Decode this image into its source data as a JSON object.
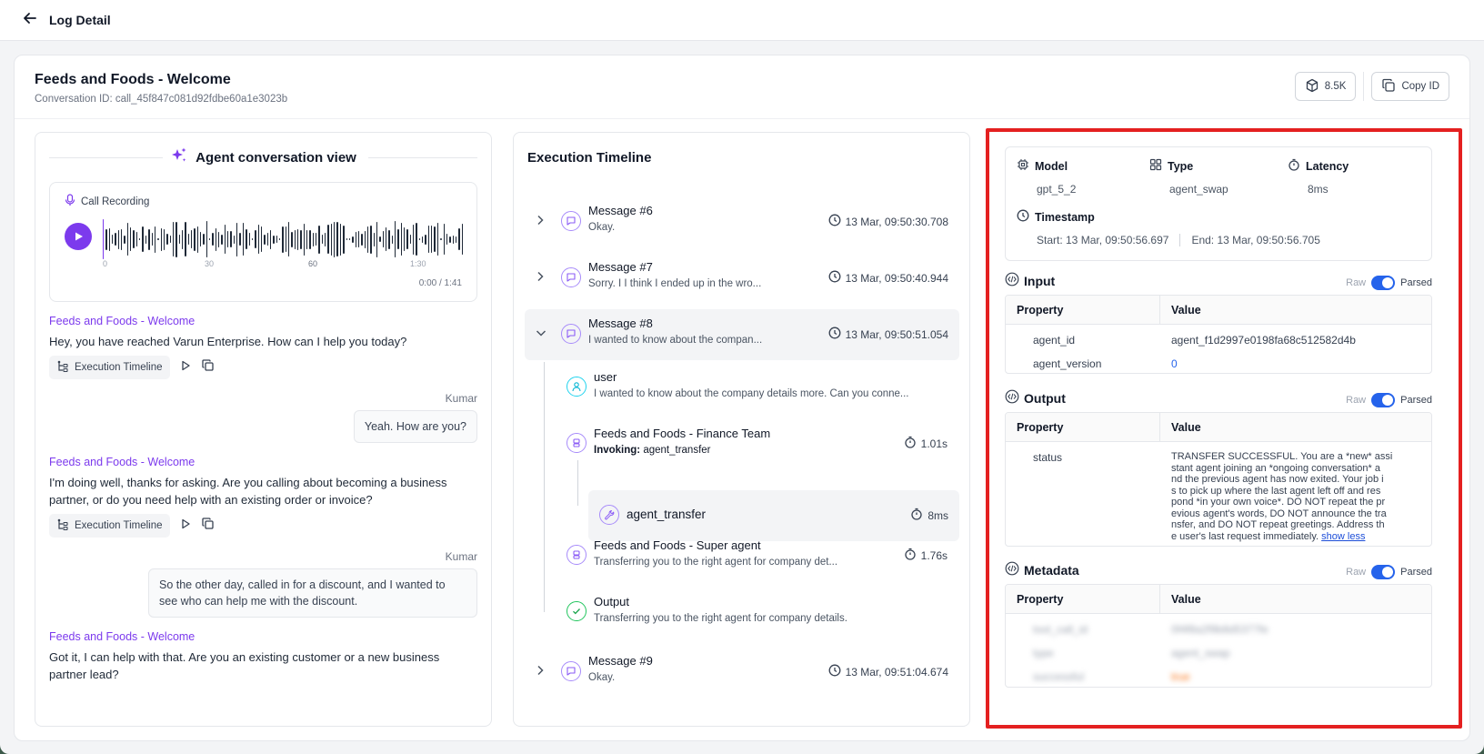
{
  "topbar": {
    "title": "Log Detail"
  },
  "header": {
    "title": "Feeds and Foods - Welcome",
    "conversation_id": "Conversation ID: call_45f847c081d92fdbe60a1e3023b",
    "tokens": "8.5K",
    "copy_id": "Copy ID"
  },
  "conversation": {
    "title": "Agent conversation view",
    "recording_label": "Call Recording",
    "ruler": [
      "0",
      "30",
      "60",
      "1:30"
    ],
    "time": "0:00 / 1:41",
    "exec_label": "Execution Timeline",
    "messages": [
      {
        "agent": "Feeds and Foods - Welcome",
        "text": "Hey, you have reached Varun Enterprise. How can I help you today?"
      },
      {
        "user": "Kumar",
        "text": "Yeah. How are you?"
      },
      {
        "agent": "Feeds and Foods - Welcome",
        "text": "I'm doing well, thanks for asking. Are you calling about becoming a business partner, or do you need help with an existing order or invoice?"
      },
      {
        "user": "Kumar",
        "text": "So the other day, called in for a discount, and I wanted to see who can help me with the discount."
      },
      {
        "agent": "Feeds and Foods - Welcome",
        "text": "Got it, I can help with that. Are you an existing customer or a new business partner lead?"
      }
    ]
  },
  "timeline": {
    "title": "Execution Timeline",
    "rows": [
      {
        "title": "Message #6",
        "sub": "Okay.",
        "time": "13 Mar, 09:50:30.708"
      },
      {
        "title": "Message #7",
        "sub": "Sorry. I I think I ended up in the wro...",
        "time": "13 Mar, 09:50:40.944"
      },
      {
        "title": "Message #8",
        "sub": "I wanted to know about the compan...",
        "time": "13 Mar, 09:50:51.054"
      },
      {
        "title": "Message #9",
        "sub": "Okay.",
        "time": "13 Mar, 09:51:04.674"
      }
    ],
    "children": [
      {
        "title": "user",
        "sub": "I wanted to know about the company details more. Can you conne...",
        "time": ""
      },
      {
        "title": "Feeds and Foods - Finance Team",
        "sub_label": "Invoking:",
        "sub": "agent_transfer",
        "time": "1.01s"
      },
      {
        "title": "agent_transfer",
        "time": "8ms"
      },
      {
        "title": "Feeds and Foods - Super agent",
        "sub": "Transferring you to the right agent for company det...",
        "time": "1.76s"
      },
      {
        "title": "Output",
        "sub": "Transferring you to the right agent for company details."
      }
    ]
  },
  "details": {
    "model_label": "Model",
    "model": "gpt_5_2",
    "type_label": "Type",
    "type": "agent_swap",
    "latency_label": "Latency",
    "latency": "8ms",
    "timestamp_label": "Timestamp",
    "start": "Start: 13 Mar, 09:50:56.697",
    "end": "End: 13 Mar, 09:50:56.705",
    "raw": "Raw",
    "parsed": "Parsed",
    "property": "Property",
    "value": "Value",
    "input": {
      "title": "Input",
      "rows": [
        {
          "k": "agent_id",
          "v": "agent_f1d2997e0198fa68c512582d4b"
        },
        {
          "k": "agent_version",
          "v": "0"
        }
      ]
    },
    "output": {
      "title": "Output",
      "key": "status",
      "lines": [
        "TRANSFER SUCCESSFUL. You are a *new* assi",
        "stant agent joining an *ongoing conversation* a",
        "nd the previous agent has now exited. Your job i",
        "s to pick up where the last agent left off and res",
        "pond *in your own voice*. DO NOT repeat the pr",
        "evious agent's words, DO NOT announce the tra",
        "nsfer, and DO NOT repeat greetings. Address th",
        "e user's last request immediately."
      ],
      "show_less": "show less"
    },
    "metadata": {
      "title": "Metadata",
      "rows": [
        {
          "k": "tool_call_id",
          "v": "0f4f8a2f9b8d5377fe"
        },
        {
          "k": "type",
          "v": "agent_swap"
        },
        {
          "k": "successful",
          "v": "true"
        }
      ]
    }
  }
}
